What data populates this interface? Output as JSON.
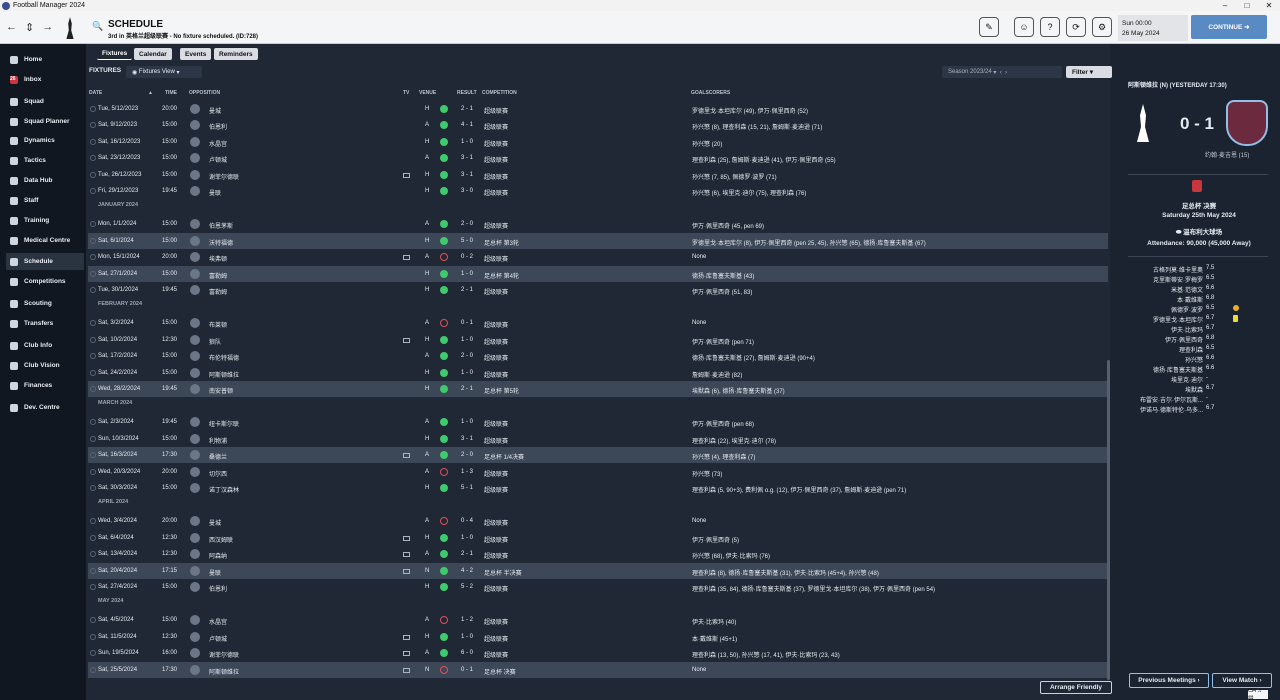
{
  "window": {
    "title": "Football Manager 2024",
    "min": "–",
    "max": "□",
    "close": "✕"
  },
  "header": {
    "title": "SCHEDULE",
    "subtitle": "3rd in 英格兰超级联赛 - No fixture scheduled. (ID:728)",
    "date_time": "Sun 00:00",
    "date": "26 May 2024",
    "continue": "CONTINUE"
  },
  "sidebar": {
    "items": [
      "Home",
      "Inbox",
      "Squad",
      "Squad Planner",
      "Dynamics",
      "Tactics",
      "Data Hub",
      "Staff",
      "Training",
      "Medical Centre",
      "Schedule",
      "Competitions",
      "Scouting",
      "Transfers",
      "Club Info",
      "Club Vision",
      "Finances",
      "Dev. Centre"
    ],
    "inbox_badge": "26"
  },
  "tabs": [
    "Fixtures",
    "Calendar",
    "Events",
    "Reminders"
  ],
  "toolbar": {
    "fixtures_label": "FIXTURES",
    "view": "Fixtures View",
    "season": "Season 2023/24",
    "filter": "Filter"
  },
  "columns": {
    "date": "DATE",
    "time": "TIME",
    "opposition": "OPPOSITION",
    "tv": "TV",
    "venue": "VENUE",
    "result": "RESULT",
    "competition": "COMPETITION",
    "goalscorers": "GOALSCORERS"
  },
  "rows": [
    {
      "date": "Tue, 5/12/2023",
      "time": "20:00",
      "opp": "曼城",
      "venue": "H",
      "res": "w",
      "score": "2 - 1",
      "comp": "超级联赛",
      "goals": "罗德里戈·本坦库尔 (49), 伊万·佩里西奇 (52)"
    },
    {
      "date": "Sat, 9/12/2023",
      "time": "15:00",
      "opp": "伯恩利",
      "venue": "A",
      "res": "w",
      "score": "4 - 1",
      "comp": "超级联赛",
      "goals": "孙兴慜 (8), 理查利森 (15, 21), 詹姆斯·麦迪逊 (71)"
    },
    {
      "date": "Sat, 16/12/2023",
      "time": "15:00",
      "opp": "水晶宫",
      "venue": "H",
      "res": "w",
      "score": "1 - 0",
      "comp": "超级联赛",
      "goals": "孙兴慜 (20)"
    },
    {
      "date": "Sat, 23/12/2023",
      "time": "15:00",
      "opp": "卢顿城",
      "venue": "A",
      "res": "w",
      "score": "3 - 1",
      "comp": "超级联赛",
      "goals": "理查利森 (25), 詹姆斯·麦迪逊 (41), 伊万·佩里西奇 (55)"
    },
    {
      "date": "Tue, 26/12/2023",
      "time": "15:00",
      "opp": "谢菲尔德联",
      "venue": "H",
      "res": "w",
      "score": "3 - 1",
      "comp": "超级联赛",
      "goals": "孙兴慜 (7, 85), 佩德罗·波罗 (71)",
      "tv": true
    },
    {
      "date": "Fri, 29/12/2023",
      "time": "19:45",
      "opp": "曼联",
      "venue": "H",
      "res": "w",
      "score": "3 - 0",
      "comp": "超级联赛",
      "goals": "孙兴慜 (6), 埃里克·迪尔 (75), 理查利森 (76)"
    },
    {
      "month": "JANUARY 2024"
    },
    {
      "date": "Mon, 1/1/2024",
      "time": "15:00",
      "opp": "伯恩茅斯",
      "venue": "A",
      "res": "w",
      "score": "2 - 0",
      "comp": "超级联赛",
      "goals": "伊万·佩里西奇 (45, pen 69)"
    },
    {
      "date": "Sat, 6/1/2024",
      "time": "15:00",
      "opp": "沃特福德",
      "venue": "H",
      "res": "w",
      "score": "5 - 0",
      "comp": "足总杯 第3轮",
      "goals": "罗德里戈·本坦库尔 (8), 伊万·佩里西奇 (pen 25, 45), 孙兴慜 (65), 德扬·库鲁塞夫斯基 (67)",
      "hl": true
    },
    {
      "date": "Mon, 15/1/2024",
      "time": "20:00",
      "opp": "埃弗顿",
      "venue": "A",
      "res": "l",
      "score": "0 - 2",
      "comp": "超级联赛",
      "goals": "None",
      "tv": true
    },
    {
      "date": "Sat, 27/1/2024",
      "time": "15:00",
      "opp": "富勒姆",
      "venue": "H",
      "res": "w",
      "score": "1 - 0",
      "comp": "足总杯 第4轮",
      "goals": "德扬·库鲁塞夫斯基 (43)",
      "hl": true
    },
    {
      "date": "Tue, 30/1/2024",
      "time": "19:45",
      "opp": "富勒姆",
      "venue": "H",
      "res": "w",
      "score": "2 - 1",
      "comp": "超级联赛",
      "goals": "伊万·佩里西奇 (51, 83)"
    },
    {
      "month": "FEBRUARY 2024"
    },
    {
      "date": "Sat, 3/2/2024",
      "time": "15:00",
      "opp": "布莱顿",
      "venue": "A",
      "res": "l",
      "score": "0 - 1",
      "comp": "超级联赛",
      "goals": "None"
    },
    {
      "date": "Sat, 10/2/2024",
      "time": "12:30",
      "opp": "狼队",
      "venue": "H",
      "res": "w",
      "score": "1 - 0",
      "comp": "超级联赛",
      "goals": "伊万·佩里西奇 (pen 71)",
      "tv": true
    },
    {
      "date": "Sat, 17/2/2024",
      "time": "15:00",
      "opp": "布伦特福德",
      "venue": "A",
      "res": "w",
      "score": "2 - 0",
      "comp": "超级联赛",
      "goals": "德扬·库鲁塞夫斯基 (27), 詹姆斯·麦迪逊 (90+4)"
    },
    {
      "date": "Sat, 24/2/2024",
      "time": "15:00",
      "opp": "阿斯顿维拉",
      "venue": "H",
      "res": "w",
      "score": "1 - 0",
      "comp": "超级联赛",
      "goals": "詹姆斯·麦迪逊 (82)"
    },
    {
      "date": "Wed, 28/2/2024",
      "time": "19:45",
      "opp": "南安普顿",
      "venue": "H",
      "res": "w",
      "score": "2 - 1",
      "comp": "足总杯 第5轮",
      "goals": "埃默森 (6), 德扬·库鲁塞夫斯基 (37)",
      "hl": true
    },
    {
      "month": "MARCH 2024"
    },
    {
      "date": "Sat, 2/3/2024",
      "time": "19:45",
      "opp": "纽卡斯尔联",
      "venue": "A",
      "res": "w",
      "score": "1 - 0",
      "comp": "超级联赛",
      "goals": "伊万·佩里西奇 (pen 68)"
    },
    {
      "date": "Sun, 10/3/2024",
      "time": "15:00",
      "opp": "利物浦",
      "venue": "H",
      "res": "w",
      "score": "3 - 1",
      "comp": "超级联赛",
      "goals": "理查利森 (22), 埃里克·迪尔 (78)"
    },
    {
      "date": "Sat, 16/3/2024",
      "time": "17:30",
      "opp": "桑德兰",
      "venue": "A",
      "res": "w",
      "score": "2 - 0",
      "comp": "足总杯 1/4决赛",
      "goals": "孙兴慜 (4), 理查利森 (7)",
      "hl": true,
      "tv": true
    },
    {
      "date": "Wed, 20/3/2024",
      "time": "20:00",
      "opp": "切尔西",
      "venue": "A",
      "res": "l",
      "score": "1 - 3",
      "comp": "超级联赛",
      "goals": "孙兴慜 (73)"
    },
    {
      "date": "Sat, 30/3/2024",
      "time": "15:00",
      "opp": "诺丁汉森林",
      "venue": "H",
      "res": "w",
      "score": "5 - 1",
      "comp": "超级联赛",
      "goals": "理查利森 (5, 90+3), 费利佩 o.g. (12), 伊万·佩里西奇 (37), 詹姆斯·麦迪逊 (pen 71)"
    },
    {
      "month": "APRIL 2024"
    },
    {
      "date": "Wed, 3/4/2024",
      "time": "20:00",
      "opp": "曼城",
      "venue": "A",
      "res": "l",
      "score": "0 - 4",
      "comp": "超级联赛",
      "goals": "None"
    },
    {
      "date": "Sat, 6/4/2024",
      "time": "12:30",
      "opp": "西汉姆联",
      "venue": "H",
      "res": "w",
      "score": "1 - 0",
      "comp": "超级联赛",
      "goals": "伊万·佩里西奇 (5)",
      "tv": true
    },
    {
      "date": "Sat, 13/4/2024",
      "time": "12:30",
      "opp": "阿森纳",
      "venue": "A",
      "res": "w",
      "score": "2 - 1",
      "comp": "超级联赛",
      "goals": "孙兴慜 (68), 伊夫·比索玛 (76)",
      "tv": true
    },
    {
      "date": "Sat, 20/4/2024",
      "time": "17:15",
      "opp": "曼联",
      "venue": "N",
      "res": "w",
      "score": "4 - 2",
      "comp": "足总杯 半决赛",
      "goals": "理查利森 (8), 德扬·库鲁塞夫斯基 (31), 伊夫·比索玛 (45+4), 孙兴慜 (48)",
      "hl": true,
      "tv": true
    },
    {
      "date": "Sat, 27/4/2024",
      "time": "15:00",
      "opp": "伯恩利",
      "venue": "H",
      "res": "w",
      "score": "5 - 2",
      "comp": "超级联赛",
      "goals": "理查利森 (35, 84), 德扬·库鲁塞夫斯基 (37), 罗德里戈·本坦库尔 (38), 伊万·佩里西奇 (pen 54)"
    },
    {
      "month": "MAY 2024"
    },
    {
      "date": "Sat, 4/5/2024",
      "time": "15:00",
      "opp": "水晶宫",
      "venue": "A",
      "res": "l",
      "score": "1 - 2",
      "comp": "超级联赛",
      "goals": "伊夫·比索玛 (40)"
    },
    {
      "date": "Sat, 11/5/2024",
      "time": "12:30",
      "opp": "卢顿城",
      "venue": "H",
      "res": "w",
      "score": "1 - 0",
      "comp": "超级联赛",
      "goals": "本·戴维斯 (45+1)",
      "tv": true
    },
    {
      "date": "Sun, 19/5/2024",
      "time": "16:00",
      "opp": "谢菲尔德联",
      "venue": "A",
      "res": "w",
      "score": "6 - 0",
      "comp": "超级联赛",
      "goals": "理查利森 (13, 50), 孙兴慜 (17, 41), 伊夫·比索玛 (23, 43)",
      "tv": true
    },
    {
      "date": "Sat, 25/5/2024",
      "time": "17:30",
      "opp": "阿斯顿维拉",
      "venue": "N",
      "res": "l",
      "score": "0 - 1",
      "comp": "足总杯 决赛",
      "goals": "None",
      "hl": true,
      "tv": true
    }
  ],
  "right": {
    "last_result": "阿斯顿维拉 (N) (YESTERDAY 17:30)",
    "score": "0 - 1",
    "scorer": "约翰·麦吉恩 (15)",
    "cup": "足总杯 决赛",
    "match_date": "Saturday 25th May 2024",
    "stadium": "温布利大球场",
    "attendance": "Attendance: 90,000 (45,000 Away)",
    "players": [
      [
        "古格列莫·维卡里奥",
        "7.5"
      ],
      [
        "克里斯蒂安·罗梅罗",
        "6.5"
      ],
      [
        "米基·范德文",
        "6.6"
      ],
      [
        "本·戴维斯",
        "6.8"
      ],
      [
        "佩德罗·波罗",
        "6.5"
      ],
      [
        "罗德里戈·本坦库尔",
        "6.7"
      ],
      [
        "伊夫·比索玛",
        "6.7"
      ],
      [
        "伊万·佩里西奇",
        "6.8"
      ],
      [
        "理查利森",
        "6.5"
      ],
      [
        "孙兴慜",
        "6.6"
      ],
      [
        "德扬·库鲁塞夫斯基",
        "6.6"
      ],
      [
        "埃里克·迪尔",
        "-"
      ],
      [
        "埃默森",
        "6.7"
      ],
      [
        "布雷安·吉尔·伊尔瓦斯...",
        "-"
      ],
      [
        "伊诺马·德斯特伦·乌多...",
        "6.7"
      ]
    ]
  },
  "buttons": {
    "arrange": "Arrange Friendly",
    "prev": "Previous Meetings",
    "view": "View Match"
  },
  "ime": "CH ♫ 拼"
}
